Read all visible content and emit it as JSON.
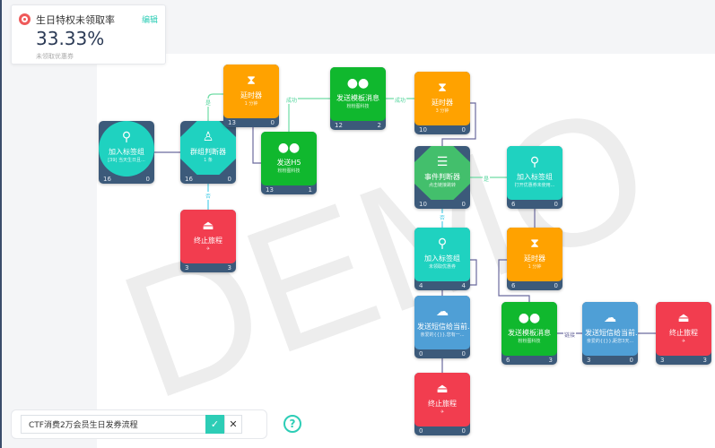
{
  "stat_card": {
    "title": "生日特权未领取率",
    "edit_label": "编辑",
    "value": "33.33%",
    "subtitle": "未领取优惠券"
  },
  "watermark": "DEMO",
  "colors": {
    "teal": "#1fd2c0",
    "orange": "#ffa200",
    "green": "#10b82e",
    "event_green": "#43bf6c",
    "blue": "#4f9fd6",
    "red": "#f23d4f",
    "footer": "#3c5a7a"
  },
  "nodes": [
    {
      "id": "n1",
      "shape": "circle",
      "color": "teal",
      "icon": "user-plus-icon",
      "label": "加入标签组",
      "sub": "[39] 当天生日且...",
      "in": "16",
      "out": "0"
    },
    {
      "id": "n2",
      "shape": "oct",
      "color": "teal",
      "icon": "group-check-icon",
      "label": "群组判断器",
      "sub": "1 条",
      "in": "16",
      "out": "0"
    },
    {
      "id": "n3",
      "shape": "rect",
      "color": "orange",
      "icon": "hourglass-icon",
      "label": "延时器",
      "sub": "1 分钟",
      "in": "13",
      "out": "0"
    },
    {
      "id": "n4",
      "shape": "rect",
      "color": "green",
      "icon": "wechat-icon",
      "label": "发送H5",
      "sub": "粉粉图科技",
      "in": "13",
      "out": "1"
    },
    {
      "id": "n5",
      "shape": "rect",
      "color": "green",
      "icon": "wechat-icon",
      "label": "发送模板消息",
      "sub": "粉粉图科技",
      "in": "12",
      "out": "2"
    },
    {
      "id": "n6",
      "shape": "rect",
      "color": "orange",
      "icon": "hourglass-icon",
      "label": "延时器",
      "sub": "3 分钟",
      "in": "10",
      "out": "0"
    },
    {
      "id": "n7",
      "shape": "oct",
      "color": "event_green",
      "icon": "list-icon",
      "label": "事件判断器",
      "sub": "点击链接跳转",
      "in": "10",
      "out": "0"
    },
    {
      "id": "n8",
      "shape": "rect",
      "color": "teal",
      "icon": "user-plus-icon",
      "label": "加入标签组",
      "sub": "打开优惠券未使用...",
      "in": "6",
      "out": "0"
    },
    {
      "id": "n9",
      "shape": "rect",
      "color": "teal",
      "icon": "user-plus-icon",
      "label": "加入标签组",
      "sub": "未领取优惠券",
      "in": "4",
      "out": "4"
    },
    {
      "id": "n10",
      "shape": "rect",
      "color": "orange",
      "icon": "hourglass-icon",
      "label": "延时器",
      "sub": "1 分钟",
      "in": "6",
      "out": "0"
    },
    {
      "id": "n11",
      "shape": "rect",
      "color": "blue",
      "icon": "cloud-icon",
      "label": "发送短信给当前...",
      "sub": "亲爱的{{}},您有一...",
      "in": "0",
      "out": "0"
    },
    {
      "id": "n12",
      "shape": "rect",
      "color": "green",
      "icon": "wechat-icon",
      "label": "发送模板消息",
      "sub": "粉粉图科技",
      "in": "6",
      "out": "3"
    },
    {
      "id": "n13",
      "shape": "rect",
      "color": "blue",
      "icon": "cloud-icon",
      "label": "发送短信给当前...",
      "sub": "亲爱的{{}},距您3天...",
      "in": "3",
      "out": "0"
    },
    {
      "id": "n14",
      "shape": "rect",
      "color": "red",
      "icon": "stop-icon",
      "label": "终止旅程",
      "sub": "✈",
      "in": "3",
      "out": "3"
    },
    {
      "id": "n15",
      "shape": "rect",
      "color": "red",
      "icon": "stop-icon",
      "label": "终止旅程",
      "sub": "✈",
      "in": "0",
      "out": "0"
    },
    {
      "id": "n16",
      "shape": "rect",
      "color": "red",
      "icon": "stop-icon",
      "label": "终止旅程",
      "sub": "✈",
      "in": "3",
      "out": "3"
    }
  ],
  "edge_labels": [
    "是",
    "否",
    "成功",
    "成功",
    "是",
    "否",
    "链接"
  ],
  "bottom": {
    "journey_name": "CTF消费2万会员生日发券流程",
    "confirm_icon": "✓",
    "cancel_icon": "✕",
    "help_icon": "?"
  }
}
